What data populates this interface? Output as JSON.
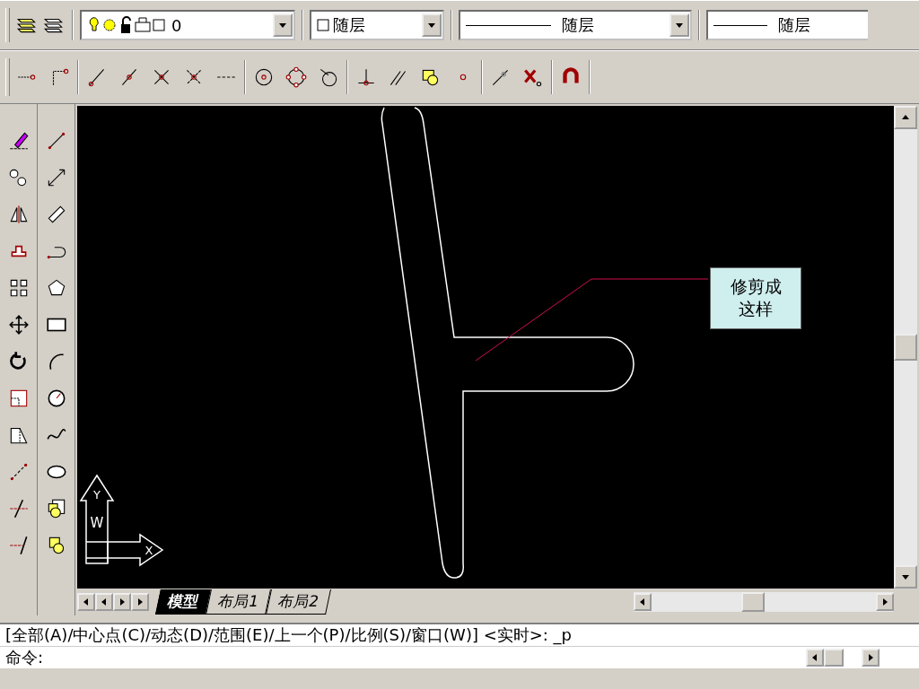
{
  "properties_toolbar": {
    "layer_value": "0",
    "color_value": "随层",
    "linetype_value": "随层",
    "lineweight_value": "随层"
  },
  "layout_tabs": [
    {
      "label": "模型",
      "selected": true
    },
    {
      "label": "布局1",
      "selected": false
    },
    {
      "label": "布局2",
      "selected": false
    }
  ],
  "drawing": {
    "callout": "修剪成这样",
    "ucs_labels": {
      "y": "Y",
      "w": "W",
      "x": "X"
    }
  },
  "command_window": {
    "history_line": "[全部(A)/中心点(C)/动态(D)/范围(E)/上一个(P)/比例(S)/窗口(W)] <实时>: _p",
    "prompt": "命令:"
  }
}
